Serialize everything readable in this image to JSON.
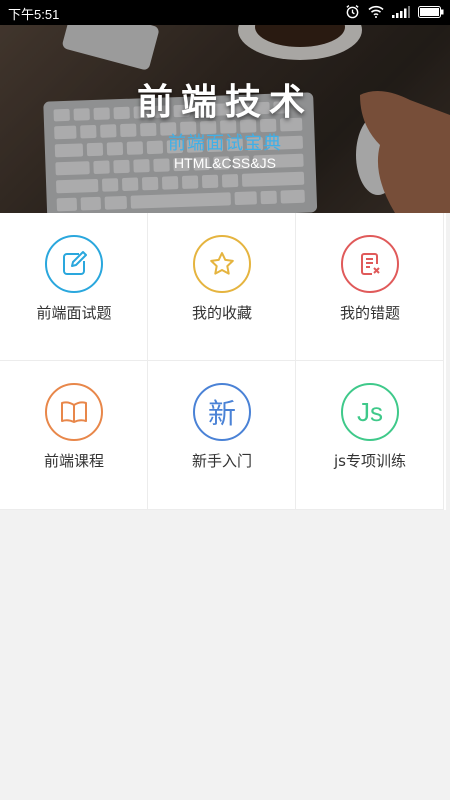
{
  "status_bar": {
    "time": "下午5:51"
  },
  "banner": {
    "title": "前端技术",
    "subtitle": "前端面试宝典",
    "tagline": "HTML&CSS&JS"
  },
  "grid": {
    "items": [
      {
        "label": "前端面试题",
        "icon": "edit-icon",
        "color": "#2aa7dd"
      },
      {
        "label": "我的收藏",
        "icon": "star-icon",
        "color": "#e5b43f"
      },
      {
        "label": "我的错题",
        "icon": "wrong-doc-icon",
        "color": "#e05a5a"
      },
      {
        "label": "前端课程",
        "icon": "book-icon",
        "color": "#e8874a"
      },
      {
        "label": "新手入门",
        "icon": "new-icon",
        "icon_text": "新",
        "color": "#4a82d6"
      },
      {
        "label": "js专项训练",
        "icon": "js-icon",
        "icon_text": "Js",
        "color": "#3fc98a"
      }
    ]
  }
}
